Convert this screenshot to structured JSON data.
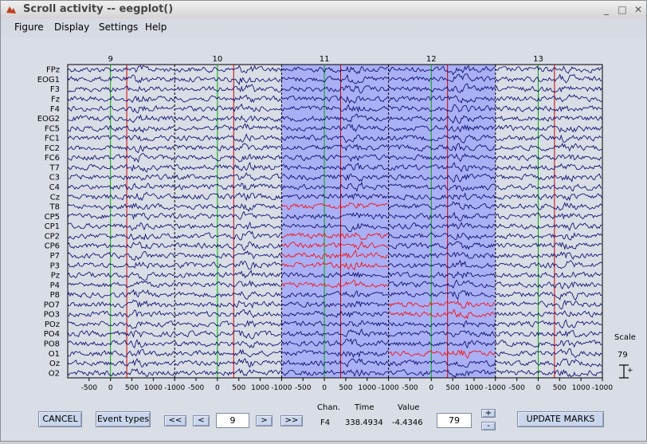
{
  "window": {
    "title": "Scroll activity -- eegplot()"
  },
  "titlebar_buttons": [
    "_",
    "□",
    "✕"
  ],
  "menu": [
    "Figure",
    "Display",
    "Settings",
    "Help"
  ],
  "channels": [
    "FPz",
    "EOG1",
    "F3",
    "Fz",
    "F4",
    "EOG2",
    "FC5",
    "FC1",
    "FC2",
    "FC6",
    "T7",
    "C3",
    "C4",
    "Cz",
    "T8",
    "CP5",
    "CP1",
    "CP2",
    "CP6",
    "P7",
    "P3",
    "Pz",
    "P4",
    "P8",
    "PO7",
    "PO3",
    "POz",
    "PO4",
    "PO8",
    "O1",
    "Oz",
    "O2"
  ],
  "epochs": [
    "9",
    "10",
    "11",
    "12",
    "13"
  ],
  "xticks": [
    "-500",
    "0",
    "500",
    "1000",
    "-1000",
    "-500",
    "0",
    "500",
    "1000",
    "-1000",
    "-500",
    "0",
    "500",
    "1000",
    "-1000",
    "-500",
    "0",
    "500",
    "1000",
    "-1000",
    "-500",
    "0",
    "500",
    "1000",
    "-1000"
  ],
  "scale": {
    "label": "Scale",
    "value": "79"
  },
  "controls": {
    "cancel": "CANCEL",
    "event_types": "Event types",
    "prev_prev": "<<",
    "prev": "<",
    "epoch_value": "9",
    "next": ">",
    "next_next": ">>",
    "scale_value": "79",
    "plus": "+",
    "minus": "-",
    "update": "UPDATE MARKS"
  },
  "readout": {
    "chan_label": "Chan.",
    "time_label": "Time",
    "value_label": "Value",
    "chan": "F4",
    "time": "338.4934",
    "value": "-4.4346"
  },
  "selection": {
    "marked_epochs": [
      "11",
      "12"
    ]
  },
  "rejected_channels": {
    "11": [
      "T8",
      "CP2",
      "CP6",
      "P7",
      "P3",
      "P4"
    ],
    "12": [
      "PO7",
      "PO3",
      "O1"
    ]
  },
  "colors": {
    "trace": "#000066",
    "rejected_trace": "#ff0000",
    "selection": "#a9b0f5",
    "event_green": "#00aa00",
    "event_red": "#cc0000",
    "background": "#d9dde6"
  }
}
